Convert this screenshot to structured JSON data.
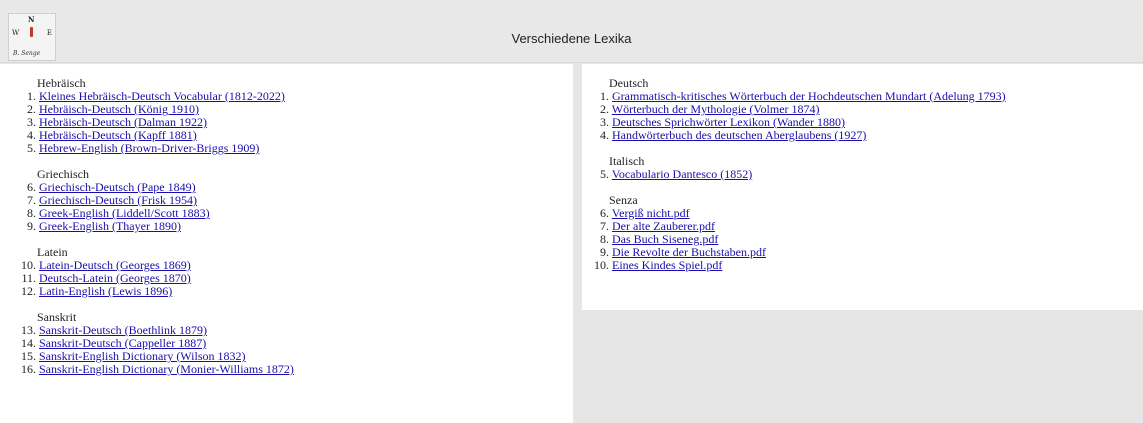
{
  "header": {
    "title": "Verschiedene Lexika",
    "logo": {
      "north": "N",
      "west": "W",
      "east": "E",
      "signature": "B. Senge"
    }
  },
  "left": [
    {
      "title": "Hebräisch",
      "items": [
        {
          "num": "1.",
          "label": "Kleines Hebräisch-Deutsch Vocabular (1812-2022)"
        },
        {
          "num": "2.",
          "label": "Hebräisch-Deutsch (König 1910)"
        },
        {
          "num": "3.",
          "label": "Hebräisch-Deutsch (Dalman 1922)"
        },
        {
          "num": "4.",
          "label": "Hebräisch-Deutsch (Kapff 1881)"
        },
        {
          "num": "5.",
          "label": "Hebrew-English (Brown-Driver-Briggs 1909)"
        }
      ]
    },
    {
      "title": "Griechisch",
      "items": [
        {
          "num": "6.",
          "label": "Griechisch-Deutsch (Pape 1849)"
        },
        {
          "num": "7.",
          "label": "Griechisch-Deutsch (Frisk 1954)"
        },
        {
          "num": "8.",
          "label": "Greek-English (Liddell/Scott 1883)"
        },
        {
          "num": "9.",
          "label": "Greek-English (Thayer 1890)"
        }
      ]
    },
    {
      "title": "Latein",
      "items": [
        {
          "num": "10.",
          "label": "Latein-Deutsch (Georges 1869)"
        },
        {
          "num": "11.",
          "label": "Deutsch-Latein (Georges 1870)"
        },
        {
          "num": "12.",
          "label": "Latin-English (Lewis 1896)"
        }
      ]
    },
    {
      "title": "Sanskrit",
      "items": [
        {
          "num": "13.",
          "label": "Sanskrit-Deutsch (Boethlink 1879)"
        },
        {
          "num": "14.",
          "label": "Sanskrit-Deutsch (Cappeller 1887)"
        },
        {
          "num": "15.",
          "label": "Sanskrit-English Dictionary (Wilson 1832)"
        },
        {
          "num": "16.",
          "label": "Sanskrit-English Dictionary (Monier-Williams 1872)"
        }
      ]
    }
  ],
  "right": [
    {
      "title": "Deutsch",
      "items": [
        {
          "num": "1.",
          "label": "Grammatisch-kritisches Wörterbuch der Hochdeutschen Mundart (Adelung 1793)"
        },
        {
          "num": "2.",
          "label": "Wörterbuch der Mythologie (Volmer 1874)"
        },
        {
          "num": "3.",
          "label": "Deutsches Sprichwörter Lexikon (Wander 1880)"
        },
        {
          "num": "4.",
          "label": "Handwörterbuch des deutschen Aberglaubens (1927)"
        }
      ]
    },
    {
      "title": "Italisch",
      "items": [
        {
          "num": "5.",
          "label": "Vocabulario Dantesco (1852)"
        }
      ]
    },
    {
      "title": "Senza",
      "items": [
        {
          "num": "6.",
          "label": "Vergiß nicht.pdf"
        },
        {
          "num": "7.",
          "label": "Der alte Zauberer.pdf"
        },
        {
          "num": "8.",
          "label": "Das Buch Siseneg.pdf"
        },
        {
          "num": "9.",
          "label": "Die Revolte der Buchstaben.pdf"
        },
        {
          "num": "10.",
          "label": "Eines Kindes Spiel.pdf"
        }
      ]
    }
  ]
}
